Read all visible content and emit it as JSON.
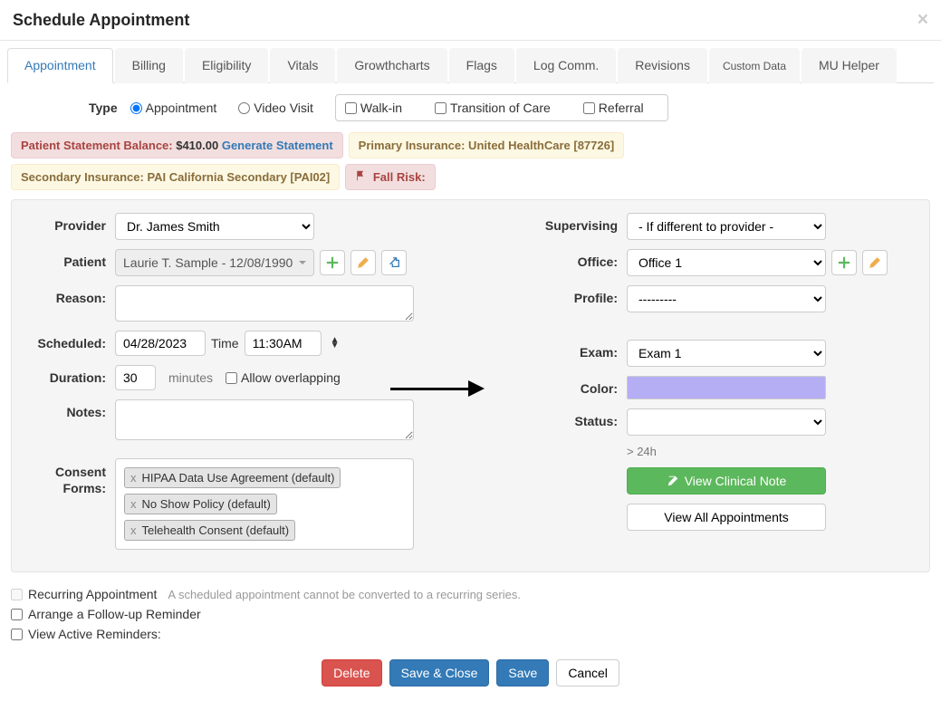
{
  "header": {
    "title": "Schedule Appointment"
  },
  "tabs": [
    "Appointment",
    "Billing",
    "Eligibility",
    "Vitals",
    "Growthcharts",
    "Flags",
    "Log Comm.",
    "Revisions",
    "Custom Data",
    "MU Helper"
  ],
  "activeTab": 0,
  "type": {
    "label": "Type",
    "radios": [
      "Appointment",
      "Video Visit"
    ],
    "radioSelected": 0,
    "checks": [
      "Walk-in",
      "Transition of Care",
      "Referral"
    ]
  },
  "alerts": {
    "balance_prefix": "Patient Statement Balance: ",
    "balance_amount": "$410.00",
    "balance_gen": "Generate Statement",
    "primary": "Primary Insurance: United HealthCare [87726]",
    "secondary": "Secondary Insurance: PAI California Secondary [PAI02]",
    "fall": "Fall Risk:"
  },
  "left": {
    "provider_label": "Provider",
    "provider_value": "Dr. James Smith",
    "patient_label": "Patient",
    "patient_value": "Laurie T. Sample - 12/08/1990",
    "reason_label": "Reason:",
    "scheduled_label": "Scheduled:",
    "date_value": "04/28/2023",
    "time_label": "Time",
    "time_value": "11:30AM",
    "duration_label": "Duration:",
    "duration_value": "30",
    "minutes_label": "minutes",
    "overlap_label": "Allow overlapping",
    "notes_label": "Notes:",
    "consent_label": "Consent Forms:",
    "consent_tags": [
      "HIPAA Data Use Agreement (default)",
      "No Show Policy (default)",
      "Telehealth Consent (default)"
    ]
  },
  "right": {
    "supervising_label": "Supervising",
    "supervising_value": "- If different to provider -",
    "office_label": "Office:",
    "office_value": "Office 1",
    "profile_label": "Profile:",
    "profile_value": "---------",
    "exam_label": "Exam:",
    "exam_value": "Exam 1",
    "color_label": "Color:",
    "color_value": "#b5aef5",
    "status_label": "Status:",
    "gt24": "> 24h",
    "view_clinical": "View Clinical Note",
    "view_all": "View All Appointments"
  },
  "recurring": {
    "recurring_label": "Recurring Appointment",
    "recurring_note": "A scheduled appointment cannot be converted to a recurring series.",
    "follow_label": "Arrange a Follow-up Reminder",
    "active_label": "View Active Reminders:"
  },
  "footer": {
    "delete": "Delete",
    "save_close": "Save & Close",
    "save": "Save",
    "cancel": "Cancel"
  }
}
